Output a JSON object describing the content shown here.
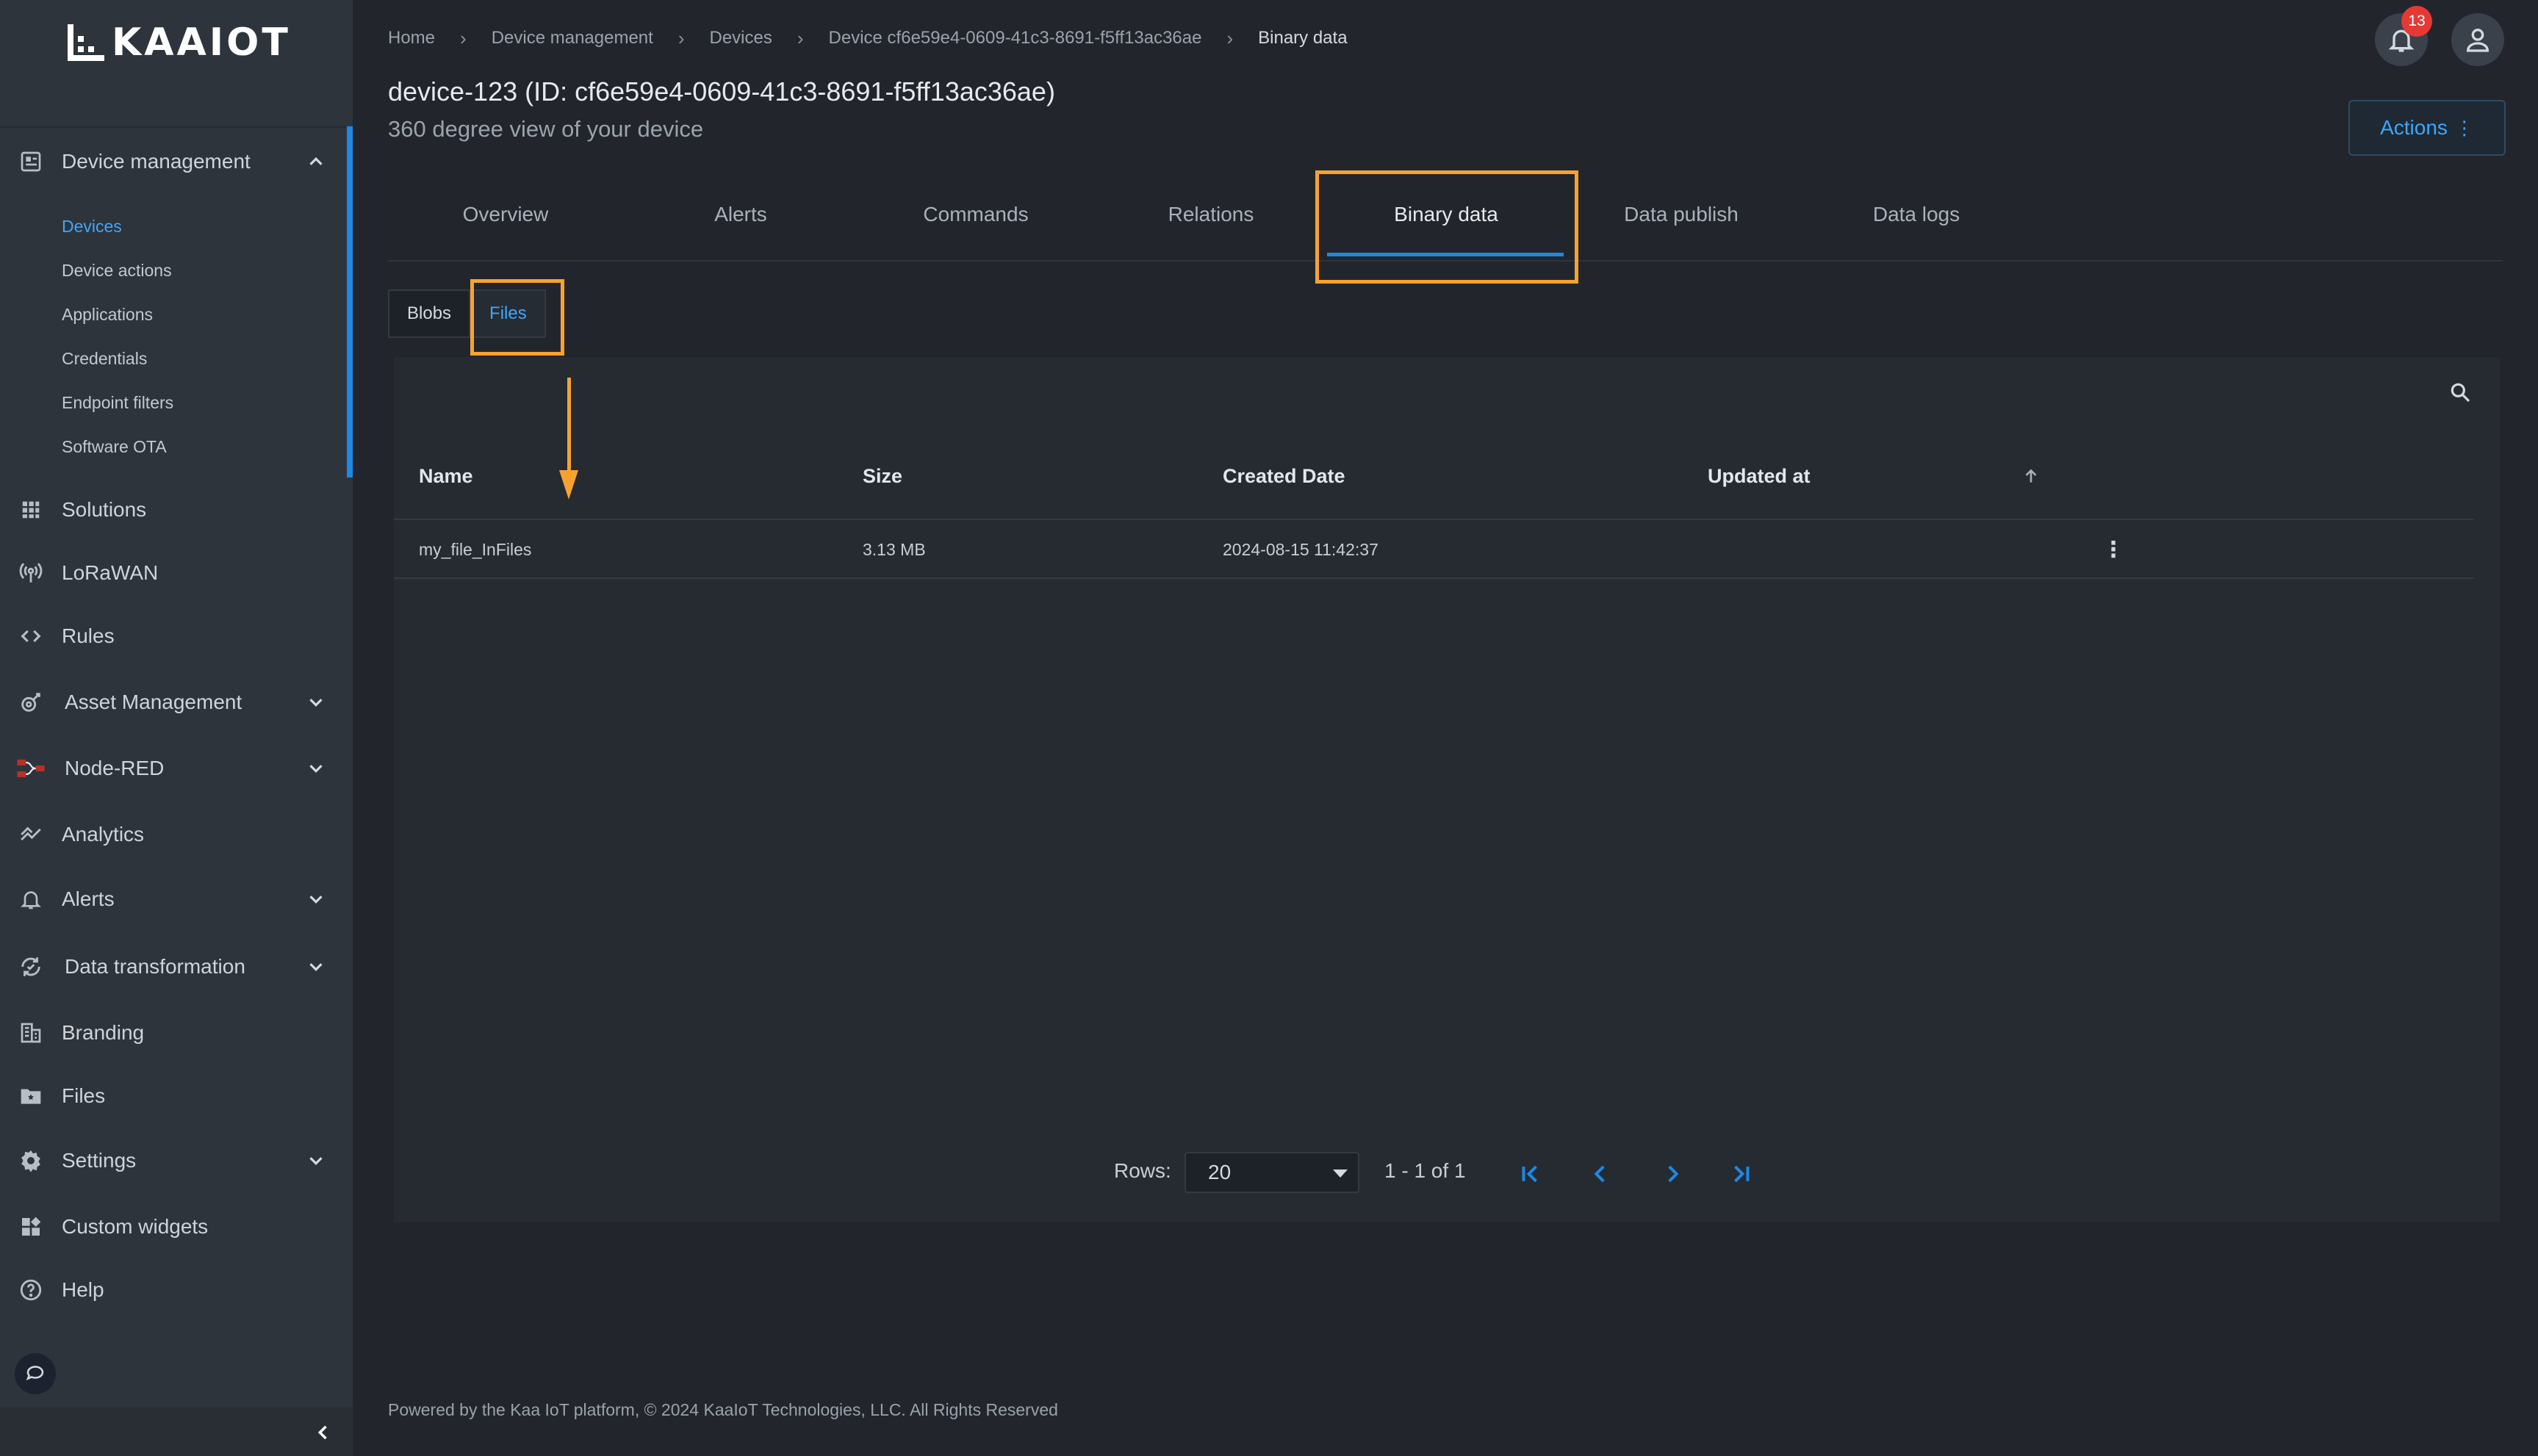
{
  "app": {
    "logo_text": "KAAIOT"
  },
  "sidebar": {
    "sections": [
      {
        "label": "Device management",
        "icon": "device-management-icon",
        "expanded": true,
        "sub_items": [
          "Devices",
          "Device actions",
          "Applications",
          "Credentials",
          "Endpoint filters",
          "Software OTA"
        ],
        "active_sub_item": "Devices"
      },
      {
        "label": "Solutions",
        "icon": "grid-icon"
      },
      {
        "label": "LoRaWAN",
        "icon": "antenna-icon"
      },
      {
        "label": "Rules",
        "icon": "code-icon"
      },
      {
        "label": "Asset Management",
        "icon": "asset-icon",
        "has_children": true
      },
      {
        "label": "Node-RED",
        "icon": "node-red-icon",
        "has_children": true
      },
      {
        "label": "Analytics",
        "icon": "analytics-icon"
      },
      {
        "label": "Alerts",
        "icon": "bell-icon",
        "has_children": true
      },
      {
        "label": "Data transformation",
        "icon": "transform-icon",
        "has_children": true
      },
      {
        "label": "Branding",
        "icon": "branding-icon"
      },
      {
        "label": "Files",
        "icon": "folder-icon"
      },
      {
        "label": "Settings",
        "icon": "gear-icon",
        "has_children": true
      },
      {
        "label": "Custom widgets",
        "icon": "widgets-icon"
      },
      {
        "label": "Help",
        "icon": "help-icon"
      }
    ]
  },
  "breadcrumb": [
    "Home",
    "Device management",
    "Devices",
    "Device cf6e59e4-0609-41c3-8691-f5ff13ac36ae",
    "Binary data"
  ],
  "header": {
    "title": "device-123 (ID: cf6e59e4-0609-41c3-8691-f5ff13ac36ae)",
    "subtitle": "360 degree view of your device",
    "notification_count": "13",
    "actions_label": "Actions"
  },
  "tabs": [
    "Overview",
    "Alerts",
    "Commands",
    "Relations",
    "Binary data",
    "Data publish",
    "Data logs"
  ],
  "active_tab": "Binary data",
  "subtabs": [
    "Blobs",
    "Files"
  ],
  "active_subtab": "Files",
  "table": {
    "columns": [
      "Name",
      "Size",
      "Created Date",
      "Updated at"
    ],
    "rows": [
      {
        "name": "my_file_InFiles",
        "size": "3.13 MB",
        "created": "2024-08-15 11:42:37",
        "updated": ""
      }
    ]
  },
  "pagination": {
    "rows_label": "Rows:",
    "rows_value": "20",
    "range": "1 - 1 of 1"
  },
  "footer": "Powered by the Kaa IoT platform, © 2024 KaaIoT Technologies, LLC. All Rights Reserved",
  "colors": {
    "accent": "#1e88e5",
    "highlight": "#f6a233",
    "badge": "#e53935"
  }
}
